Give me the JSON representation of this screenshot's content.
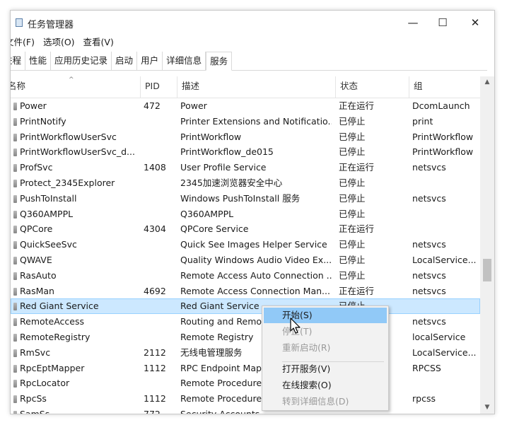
{
  "window": {
    "title": "任务管理器",
    "min_glyph": "—",
    "max_glyph": "☐",
    "close_glyph": "✕"
  },
  "menubar": [
    "文件(F)",
    "选项(O)",
    "查看(V)"
  ],
  "tabs": [
    "进程",
    "性能",
    "应用历史记录",
    "启动",
    "用户",
    "详细信息",
    "服务"
  ],
  "active_tab": "服务",
  "columns": {
    "name": "名称",
    "pid": "PID",
    "desc": "描述",
    "status": "状态",
    "group": "组"
  },
  "sort_indicator": "^",
  "rows": [
    {
      "name": "Power",
      "pid": "472",
      "desc": "Power",
      "status": "正在运行",
      "group": "DcomLaunch"
    },
    {
      "name": "PrintNotify",
      "pid": "",
      "desc": "Printer Extensions and Notificatio...",
      "status": "已停止",
      "group": "print"
    },
    {
      "name": "PrintWorkflowUserSvc",
      "pid": "",
      "desc": "PrintWorkflow",
      "status": "已停止",
      "group": "PrintWorkflow"
    },
    {
      "name": "PrintWorkflowUserSvc_d...",
      "pid": "",
      "desc": "PrintWorkflow_de015",
      "status": "已停止",
      "group": "PrintWorkflow"
    },
    {
      "name": "ProfSvc",
      "pid": "1408",
      "desc": "User Profile Service",
      "status": "正在运行",
      "group": "netsvcs"
    },
    {
      "name": "Protect_2345Explorer",
      "pid": "",
      "desc": "2345加速浏览器安全中心",
      "status": "已停止",
      "group": ""
    },
    {
      "name": "PushToInstall",
      "pid": "",
      "desc": "Windows PushToInstall 服务",
      "status": "已停止",
      "group": "netsvcs"
    },
    {
      "name": "Q360AMPPL",
      "pid": "",
      "desc": "Q360AMPPL",
      "status": "已停止",
      "group": ""
    },
    {
      "name": "QPCore",
      "pid": "4304",
      "desc": "QPCore Service",
      "status": "正在运行",
      "group": ""
    },
    {
      "name": "QuickSeeSvc",
      "pid": "",
      "desc": "Quick See Images Helper Service",
      "status": "已停止",
      "group": "netsvcs"
    },
    {
      "name": "QWAVE",
      "pid": "",
      "desc": "Quality Windows Audio Video Ex...",
      "status": "已停止",
      "group": "LocalService..."
    },
    {
      "name": "RasAuto",
      "pid": "",
      "desc": "Remote Access Auto Connection ...",
      "status": "已停止",
      "group": "netsvcs"
    },
    {
      "name": "RasMan",
      "pid": "4692",
      "desc": "Remote Access Connection Man...",
      "status": "正在运行",
      "group": "netsvcs"
    },
    {
      "name": "Red Giant Service",
      "pid": "",
      "desc": "Red Giant Service",
      "status": "已停止",
      "group": ""
    },
    {
      "name": "RemoteAccess",
      "pid": "",
      "desc": "Routing and Remo",
      "status": "",
      "group": "netsvcs"
    },
    {
      "name": "RemoteRegistry",
      "pid": "",
      "desc": "Remote Registry",
      "status": "",
      "group": "localService"
    },
    {
      "name": "RmSvc",
      "pid": "2112",
      "desc": "无线电管理服务",
      "status": "",
      "group": "LocalService..."
    },
    {
      "name": "RpcEptMapper",
      "pid": "1112",
      "desc": "RPC Endpoint Map",
      "status": "",
      "group": "RPCSS"
    },
    {
      "name": "RpcLocator",
      "pid": "",
      "desc": "Remote Procedure",
      "status": "",
      "group": ""
    },
    {
      "name": "RpcSs",
      "pid": "1112",
      "desc": "Remote Procedure",
      "status": "",
      "group": "rpcss"
    },
    {
      "name": "SamSs",
      "pid": "772",
      "desc": "Security Accounts",
      "status": "",
      "group": ""
    }
  ],
  "selected_row": "Red Giant Service",
  "context_menu": [
    {
      "label": "开始(S)",
      "state": "hover"
    },
    {
      "label": "停止(T)",
      "state": "disabled"
    },
    {
      "label": "重新启动(R)",
      "state": "disabled"
    },
    {
      "label": "打开服务(V)",
      "state": "normal"
    },
    {
      "label": "在线搜索(O)",
      "state": "normal"
    },
    {
      "label": "转到详细信息(D)",
      "state": "disabled"
    }
  ]
}
